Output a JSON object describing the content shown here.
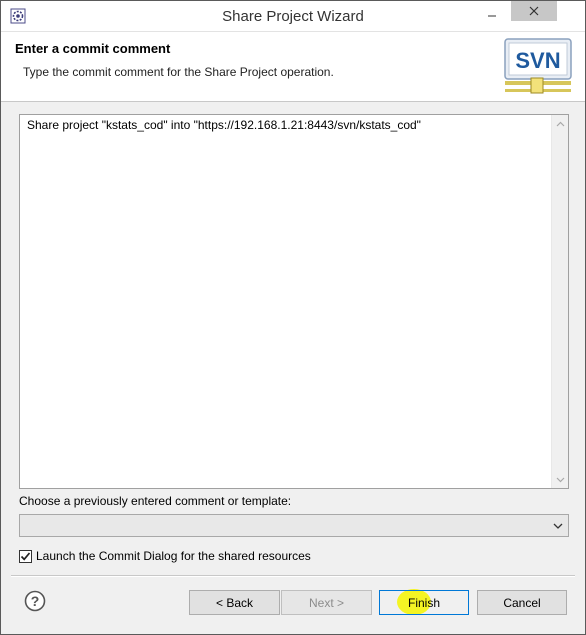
{
  "window": {
    "title": "Share Project Wizard",
    "icon": "eclipse-app-icon"
  },
  "header": {
    "title": "Enter a commit comment",
    "description": "Type the commit comment for the Share Project operation.",
    "logo_text": "SVN"
  },
  "comment": {
    "value": "Share project \"kstats_cod\" into \"https://192.168.1.21:8443/svn/kstats_cod\""
  },
  "template": {
    "label": "Choose a previously entered comment or template:",
    "selected": ""
  },
  "launch_commit": {
    "label": "Launch the Commit Dialog for the shared resources",
    "checked": true
  },
  "buttons": {
    "back": "< Back",
    "next": "Next >",
    "finish": "Finish",
    "cancel": "Cancel"
  },
  "colors": {
    "finish_border": "#0078d7",
    "highlight": "#f4f400",
    "svn_blue": "#1f5a9e"
  }
}
